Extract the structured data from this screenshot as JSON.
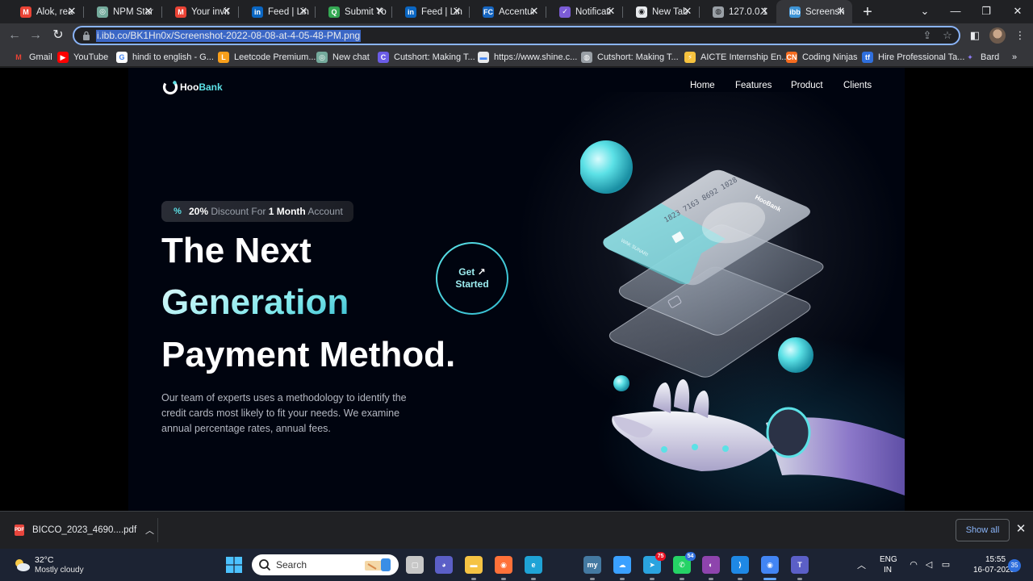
{
  "browser": {
    "tabs": [
      {
        "label": "Alok, rea",
        "icon": "gmail-icon",
        "color": "#ea4335",
        "glyph": "M"
      },
      {
        "label": "NPM Star",
        "icon": "chatgpt-icon",
        "color": "#74aa9c",
        "glyph": "◎"
      },
      {
        "label": "Your invit",
        "icon": "gmail-icon",
        "color": "#ea4335",
        "glyph": "M"
      },
      {
        "label": "Feed | Lin",
        "icon": "linkedin-icon",
        "color": "#0a66c2",
        "glyph": "in"
      },
      {
        "label": "Submit Yo",
        "icon": "search-console-icon",
        "color": "#34a853",
        "glyph": "Q"
      },
      {
        "label": "Feed | Lin",
        "icon": "linkedin-icon",
        "color": "#0a66c2",
        "glyph": "in"
      },
      {
        "label": "Accentur",
        "icon": "accenture-icon",
        "color": "#1565c0",
        "glyph": "FC"
      },
      {
        "label": "Notificati",
        "icon": "unstop-icon",
        "color": "#7b5cd6",
        "glyph": "✓"
      },
      {
        "label": "New Tab",
        "icon": "chrome-icon",
        "color": "#e8eaed",
        "glyph": "◉"
      },
      {
        "label": "127.0.0.1",
        "icon": "globe-icon",
        "color": "#9aa0a6",
        "glyph": "◍"
      },
      {
        "label": "Screensh",
        "icon": "imgbb-icon",
        "color": "#3e94d6",
        "glyph": "ibb"
      }
    ],
    "active_tab_index": 10,
    "url": "i.ibb.co/BK1Hn0x/Screenshot-2022-08-08-at-4-05-48-PM.png",
    "bookmarks": [
      {
        "label": "Gmail",
        "icon": "gmail-icon",
        "color": "#ea4335",
        "glyph": "M"
      },
      {
        "label": "YouTube",
        "icon": "youtube-icon",
        "color": "#ff0000",
        "glyph": "▶"
      },
      {
        "label": "hindi to english - G...",
        "icon": "google-icon",
        "color": "#ffffff",
        "glyph": "G"
      },
      {
        "label": "Leetcode Premium...",
        "icon": "leetcode-icon",
        "color": "#f89f1b",
        "glyph": "L"
      },
      {
        "label": "New chat",
        "icon": "chatgpt-icon",
        "color": "#74aa9c",
        "glyph": "◎"
      },
      {
        "label": "Cutshort: Making T...",
        "icon": "cutshort-icon",
        "color": "#6b5ce7",
        "glyph": "C"
      },
      {
        "label": "https://www.shine.c...",
        "icon": "shine-icon",
        "color": "#e8eaed",
        "glyph": "▬"
      },
      {
        "label": "Cutshort: Making T...",
        "icon": "globe-icon",
        "color": "#9aa0a6",
        "glyph": "◍"
      },
      {
        "label": "AICTE Internship En...",
        "icon": "aicte-icon",
        "color": "#f6c23e",
        "glyph": "⚡"
      },
      {
        "label": "Coding Ninjas",
        "icon": "codingninjas-icon",
        "color": "#f66c1f",
        "glyph": "CN"
      },
      {
        "label": "Hire Professional Ta...",
        "icon": "toptal-icon",
        "color": "#2f6fdd",
        "glyph": "tf"
      },
      {
        "label": "Bard",
        "icon": "bard-icon",
        "color": "#8e7cf6",
        "glyph": "✦"
      }
    ]
  },
  "site": {
    "logo_text_1": "Hoo",
    "logo_text_2": "Bank",
    "nav": [
      "Home",
      "Features",
      "Product",
      "Clients"
    ],
    "badge": {
      "pct": "20%",
      "mid": "Discount For",
      "bold": "1 Month",
      "end": "Account"
    },
    "headline": {
      "line1": "The Next",
      "line2": "Generation",
      "line3": "Payment Method."
    },
    "cta": {
      "line1": "Get",
      "arrow": "↗",
      "line2": "Started"
    },
    "description": "Our team of experts uses a methodology to identify the credit cards most likely to fit your needs. We examine annual percentage rates, annual fees.",
    "card_number": "1823 7163 8692 1028",
    "card_holder": "WAK SUNARI",
    "card_brand": "HooBank",
    "colors": {
      "accent": "#5ce1e6",
      "background": "#00040f"
    }
  },
  "download": {
    "file": "BICCO_2023_4690....pdf",
    "show_all": "Show all"
  },
  "taskbar": {
    "temp": "32°C",
    "weather": "Mostly cloudy",
    "search": "Search",
    "apps": [
      {
        "icon": "task-view-icon",
        "color": "#c7c7c7",
        "glyph": "▢",
        "badge": ""
      },
      {
        "icon": "teams-chat-icon",
        "color": "#5b5fc7",
        "glyph": "◕",
        "badge": ""
      },
      {
        "icon": "file-explorer-icon",
        "color": "#f5c343",
        "glyph": "▬",
        "badge": ""
      },
      {
        "icon": "firefox-icon",
        "color": "#ff7139",
        "glyph": "◉",
        "badge": ""
      },
      {
        "icon": "edge-icon",
        "color": "#1fa3d6",
        "glyph": "e",
        "badge": ""
      },
      {
        "icon": "mysql-icon",
        "color": "#4479a1",
        "glyph": "my",
        "badge": ""
      },
      {
        "icon": "weather-app-icon",
        "color": "#3aa0ff",
        "glyph": "☁",
        "badge": ""
      },
      {
        "icon": "telegram-icon",
        "color": "#2aa3df",
        "glyph": "➤",
        "badge": "75"
      },
      {
        "icon": "whatsapp-icon",
        "color": "#25d366",
        "glyph": "✆",
        "badge": "54"
      },
      {
        "icon": "discord-icon",
        "color": "#8e44ad",
        "glyph": "◐",
        "badge": ""
      },
      {
        "icon": "vscode-icon",
        "color": "#1e88e5",
        "glyph": "⟩",
        "badge": ""
      },
      {
        "icon": "chrome-icon",
        "color": "#4285f4",
        "glyph": "◉",
        "badge": ""
      },
      {
        "icon": "teams-icon",
        "color": "#5b5fc7",
        "glyph": "T",
        "badge": ""
      }
    ],
    "lang1": "ENG",
    "lang2": "IN",
    "time": "15:55",
    "date": "16-07-2023",
    "notifications": "35"
  }
}
